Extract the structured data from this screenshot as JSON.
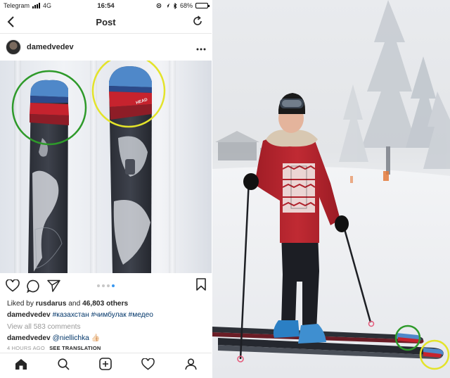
{
  "status_bar": {
    "carrier": "Telegram",
    "network": "4G",
    "time": "16:54",
    "battery": "68%",
    "battery_level": 0.68
  },
  "nav": {
    "title": "Post",
    "back_icon": "chevron-left-icon",
    "refresh_icon": "refresh-icon"
  },
  "post": {
    "username": "damedvedev",
    "more_icon": "more-icon",
    "likes_prefix": "Liked by",
    "liked_by": "rusdarus",
    "likes_and": "and",
    "likes_count": "46,803 others",
    "caption_user": "damedvedev",
    "hashtags": [
      "#казахстан",
      "#чимбулак",
      "#медео"
    ],
    "view_comments": "View all 583 comments",
    "comment_user": "damedvedev",
    "comment_mention": "@niellichka",
    "comment_emoji": "👍🏻",
    "time_ago": "4 HOURS AGO",
    "see_translation": "SEE TRANSLATION",
    "carousel_count": 4,
    "carousel_active": 4
  },
  "tabs": [
    {
      "name": "home",
      "icon": "home-icon"
    },
    {
      "name": "search",
      "icon": "search-icon"
    },
    {
      "name": "add",
      "icon": "add-icon"
    },
    {
      "name": "activity",
      "icon": "heart-icon"
    },
    {
      "name": "profile",
      "icon": "profile-icon"
    }
  ],
  "colors": {
    "highlight_green": "#2e9a2a",
    "highlight_yellow": "#e3e32a",
    "link_blue": "#003569",
    "carousel_active": "#3897f0",
    "jacket_red": "#b0212b"
  }
}
